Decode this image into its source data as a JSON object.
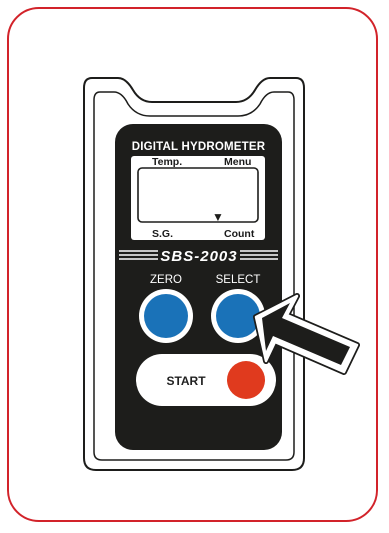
{
  "device": {
    "title": "DIGITAL HYDROMETER",
    "model": "SBS-2003",
    "screen": {
      "top_left": "Temp.",
      "top_right": "Menu",
      "bottom_left": "S.G.",
      "bottom_right": "Count",
      "cursor_glyph": "▼"
    },
    "buttons": {
      "zero_label": "ZERO",
      "select_label": "SELECT",
      "start_label": "START"
    }
  },
  "colors": {
    "frame": "#d2232a",
    "body": "#1d1d1b",
    "blue_button": "#1a72b8",
    "start_button": "#e03a1e",
    "screen": "#ffffff"
  },
  "icons": [
    "pointer-arrow-icon"
  ]
}
